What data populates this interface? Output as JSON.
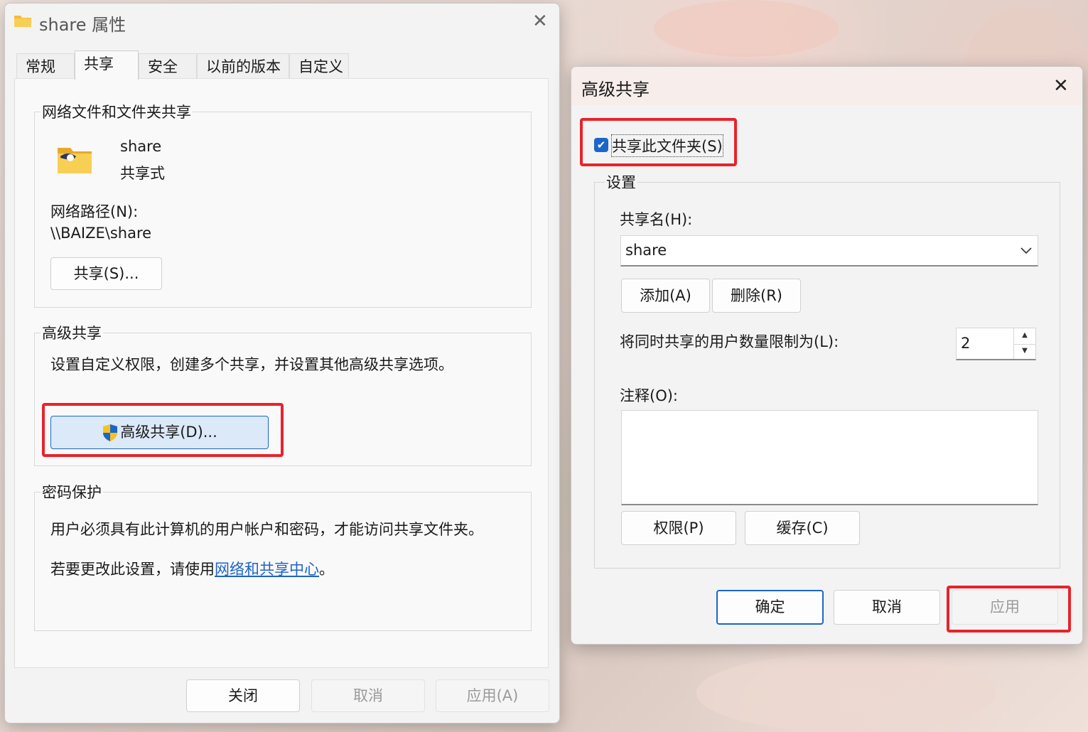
{
  "main": {
    "title": "share 属性",
    "tabs": [
      {
        "label": "常规"
      },
      {
        "label": "共享"
      },
      {
        "label": "安全"
      },
      {
        "label": "以前的版本"
      },
      {
        "label": "自定义"
      }
    ],
    "active_tab": "共享",
    "network_group": {
      "legend": "网络文件和文件夹共享",
      "folder_name": "share",
      "folder_status": "共享式",
      "path_label": "网络路径(N):",
      "path_value": "\\\\BAIZE\\share",
      "share_button": "共享(S)..."
    },
    "advanced_group": {
      "legend": "高级共享",
      "description": "设置自定义权限，创建多个共享，并设置其他高级共享选项。",
      "button": "高级共享(D)..."
    },
    "password_group": {
      "legend": "密码保护",
      "line1": "用户必须具有此计算机的用户帐户和密码，才能访问共享文件夹。",
      "line2_prefix": "若要更改此设置，请使用",
      "line2_link": "网络和共享中心",
      "line2_suffix": "。"
    },
    "buttons": {
      "close": "关闭",
      "cancel": "取消",
      "apply": "应用(A)"
    }
  },
  "advanced": {
    "title": "高级共享",
    "share_checkbox_label": "共享此文件夹(S)",
    "share_checkbox_checked": true,
    "settings_legend": "设置",
    "share_name_label": "共享名(H):",
    "share_name_value": "share",
    "add_button": "添加(A)",
    "remove_button": "删除(R)",
    "limit_label": "将同时共享的用户数量限制为(L):",
    "limit_value": "2",
    "comment_label": "注释(O):",
    "comment_value": "",
    "permissions_button": "权限(P)",
    "caching_button": "缓存(C)",
    "ok_button": "确定",
    "cancel_button": "取消",
    "apply_button": "应用"
  },
  "colors": {
    "highlight": "#e8232b",
    "accent": "#1b66c9",
    "link": "#1d63c9"
  },
  "icons": {
    "folder": "folder-icon",
    "shared_folder": "shared-folder-icon",
    "shield": "uac-shield-icon",
    "close": "close-icon",
    "dropdown": "chevron-down-icon",
    "checkbox": "checkmark-icon"
  }
}
